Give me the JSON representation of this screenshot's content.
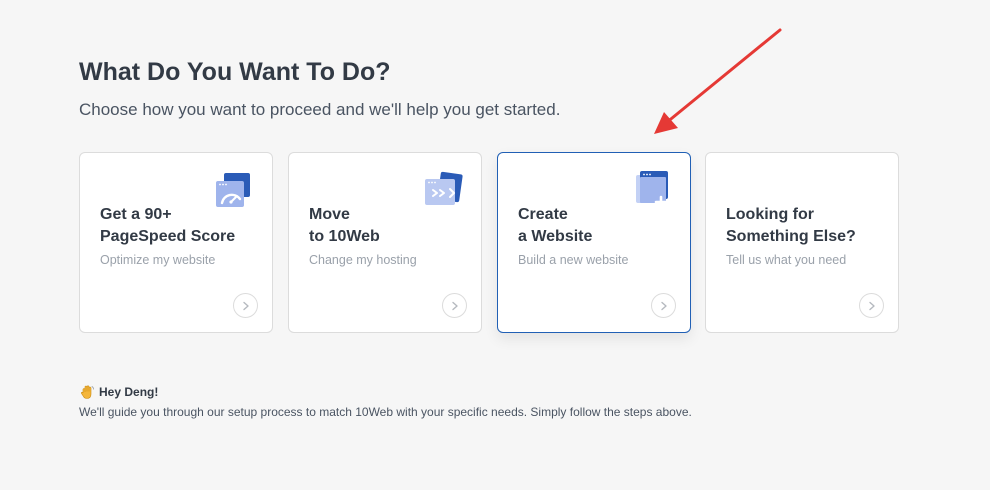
{
  "header": {
    "title": "What Do You Want To Do?",
    "subtitle": "Choose how you want to proceed and we'll help you get started."
  },
  "cards": [
    {
      "title": "Get a 90+\nPageSpeed Score",
      "description": "Optimize my website",
      "icon": "speedometer-window-icon",
      "selected": false
    },
    {
      "title": "Move\nto 10Web",
      "description": "Change my hosting",
      "icon": "migrate-window-icon",
      "selected": false
    },
    {
      "title": "Create\na Website",
      "description": "Build a new website",
      "icon": "add-window-icon",
      "selected": true
    },
    {
      "title": "Looking for\nSomething Else?",
      "description": "Tell us what you need",
      "icon": "",
      "selected": false
    }
  ],
  "footer": {
    "greeting": "Hey Deng!",
    "greeting_icon": "waving-hand-icon",
    "message": "We'll guide you through our setup process to match 10Web with your specific needs. Simply follow the steps above."
  },
  "colors": {
    "accent": "#2160b5",
    "icon_light": "#9fb4ec",
    "icon_dark": "#2a5bb7",
    "annotation": "#e53935"
  }
}
